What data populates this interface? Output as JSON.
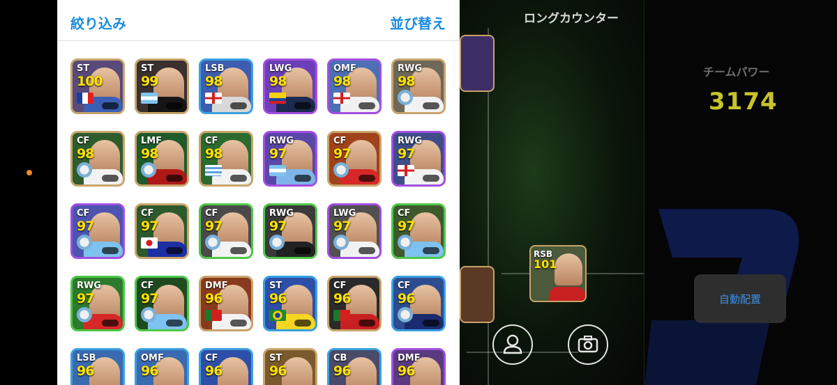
{
  "panel": {
    "filter_label": "絞り込み",
    "sort_label": "並び替え"
  },
  "cards": [
    {
      "pos": "ST",
      "rating": "100",
      "border": "#c9a46c",
      "bg": "#5a4a7a",
      "shirt": "#3a5fb5",
      "flag": "france"
    },
    {
      "pos": "ST",
      "rating": "99",
      "border": "#c9a46c",
      "bg": "#3a3030",
      "shirt": "#151515",
      "flag": "argentina"
    },
    {
      "pos": "LSB",
      "rating": "98",
      "border": "#3aa0e0",
      "bg": "#3c5db0",
      "shirt": "#d8d8d8",
      "flag": "england"
    },
    {
      "pos": "LWG",
      "rating": "98",
      "border": "#a24fe0",
      "bg": "#6b3fb8",
      "shirt": "#1c2a4f",
      "flag": "colombia"
    },
    {
      "pos": "OMF",
      "rating": "98",
      "border": "#a24fe0",
      "bg": "#4d6fb5",
      "shirt": "#f0f0f0",
      "flag": "england"
    },
    {
      "pos": "RWG",
      "rating": "98",
      "border": "#c9a46c",
      "bg": "#6d6858",
      "shirt": "#f2f2f2",
      "flag": "club"
    },
    {
      "pos": "CF",
      "rating": "98",
      "border": "#c9a46c",
      "bg": "#2f5c2c",
      "shirt": "#f2f2f2",
      "flag": "club"
    },
    {
      "pos": "LMF",
      "rating": "98",
      "border": "#c9a46c",
      "bg": "#1f5a2a",
      "shirt": "#b01818",
      "flag": "club"
    },
    {
      "pos": "CF",
      "rating": "98",
      "border": "#c9a46c",
      "bg": "#2d6a2f",
      "shirt": "#f2f2f2",
      "flag": "uruguay"
    },
    {
      "pos": "RWG",
      "rating": "97",
      "border": "#a24fe0",
      "bg": "#5a46a8",
      "shirt": "#7fb4e8",
      "flag": "argentina"
    },
    {
      "pos": "CF",
      "rating": "97",
      "border": "#c9a46c",
      "bg": "#a0421c",
      "shirt": "#d62828",
      "flag": "club"
    },
    {
      "pos": "RWG",
      "rating": "97",
      "border": "#a24fe0",
      "bg": "#3f4e8a",
      "shirt": "#f2f2f2",
      "flag": "england"
    },
    {
      "pos": "CF",
      "rating": "97",
      "border": "#a24fe0",
      "bg": "#4d54b0",
      "shirt": "#7ec2ef",
      "flag": "club"
    },
    {
      "pos": "CF",
      "rating": "97",
      "border": "#c9a46c",
      "bg": "#2c5a2c",
      "shirt": "#1c2fa3",
      "flag": "japan"
    },
    {
      "pos": "CF",
      "rating": "97",
      "border": "#4ec84a",
      "bg": "#4a4a4a",
      "shirt": "#f2f2f2",
      "flag": "club"
    },
    {
      "pos": "RWG",
      "rating": "97",
      "border": "#4ec84a",
      "bg": "#3a3a3a",
      "shirt": "#222",
      "flag": "club"
    },
    {
      "pos": "LWG",
      "rating": "97",
      "border": "#a24fe0",
      "bg": "#505050",
      "shirt": "#f2f2f2",
      "flag": "club"
    },
    {
      "pos": "CF",
      "rating": "97",
      "border": "#4ec84a",
      "bg": "#3e5a2c",
      "shirt": "#7ec2ef",
      "flag": "club"
    },
    {
      "pos": "RWG",
      "rating": "97",
      "border": "#4ec84a",
      "bg": "#2c7a2c",
      "shirt": "#d62828",
      "flag": "club"
    },
    {
      "pos": "CF",
      "rating": "97",
      "border": "#4ec84a",
      "bg": "#1f4a1f",
      "shirt": "#7ec2ef",
      "flag": "club"
    },
    {
      "pos": "DMF",
      "rating": "96",
      "border": "#c9a46c",
      "bg": "#8a3a1c",
      "shirt": "#f2f2f2",
      "flag": "portugal"
    },
    {
      "pos": "ST",
      "rating": "96",
      "border": "#3aa0e0",
      "bg": "#2d4fa8",
      "shirt": "#f5d622",
      "flag": "brazil"
    },
    {
      "pos": "CF",
      "rating": "96",
      "border": "#c9a46c",
      "bg": "#2a2a2a",
      "shirt": "#c82020",
      "flag": "portugal"
    },
    {
      "pos": "CF",
      "rating": "96",
      "border": "#3aa0e0",
      "bg": "#2d4d90",
      "shirt": "#1b2b6e",
      "flag": "club"
    },
    {
      "pos": "LSB",
      "rating": "96",
      "border": "#3aa0e0",
      "bg": "#3a6ab0",
      "shirt": "#d8d8d8",
      "flag": "none"
    },
    {
      "pos": "OMF",
      "rating": "96",
      "border": "#3aa0e0",
      "bg": "#3a6ab0",
      "shirt": "#7ec2ef",
      "flag": "none"
    },
    {
      "pos": "CF",
      "rating": "96",
      "border": "#3aa0e0",
      "bg": "#2d4fa8",
      "shirt": "#f2f2f2",
      "flag": "none"
    },
    {
      "pos": "ST",
      "rating": "96",
      "border": "#c9a46c",
      "bg": "#7a5a2c",
      "shirt": "#7fb4e8",
      "flag": "none"
    },
    {
      "pos": "CB",
      "rating": "96",
      "border": "#3aa0e0",
      "bg": "#4a4a6a",
      "shirt": "#c82020",
      "flag": "none"
    },
    {
      "pos": "DMF",
      "rating": "96",
      "border": "#a24fe0",
      "bg": "#5a3a80",
      "shirt": "#1c1c1c",
      "flag": "none"
    }
  ],
  "formation": {
    "title": "ロングカウンター",
    "players": [
      {
        "pos": "",
        "rating": ""
      },
      {
        "pos": "RSB",
        "rating": "101"
      },
      {
        "pos": "",
        "rating": ""
      }
    ]
  },
  "team": {
    "power_label": "チームパワー",
    "power_value": "3174",
    "auto_button": "自動配置"
  },
  "icons": {
    "player_icon": "person-icon",
    "camera_icon": "camera-icon"
  },
  "colors": {
    "accent_blue": "#1a8be0",
    "rating_yellow": "#ffe100",
    "team_power": "#c8c32a"
  }
}
